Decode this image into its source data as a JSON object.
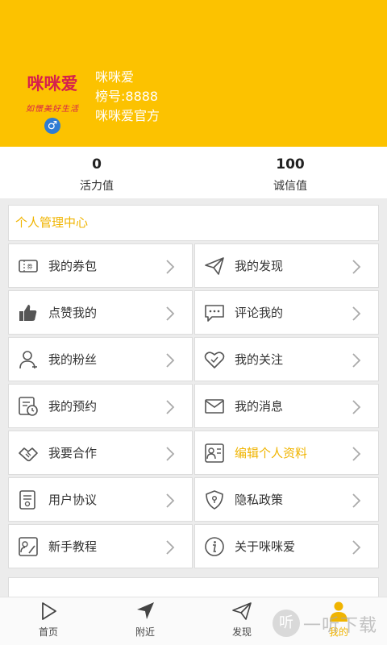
{
  "header": {
    "logo_text": "咪咪爱",
    "logo_sub": "如憬美好生活",
    "gender_symbol": "♂",
    "username": "咪咪爱",
    "rank": "榜号:8888",
    "official": "咪咪爱官方",
    "bg_color": "#fcc200"
  },
  "stats": [
    {
      "value": "0",
      "label": "活力值"
    },
    {
      "value": "100",
      "label": "诚信值"
    }
  ],
  "panel": {
    "title": "个人管理中心",
    "items": [
      {
        "label": "我的券包",
        "icon": "coupon-icon"
      },
      {
        "label": "我的发现",
        "icon": "paper-plane-icon"
      },
      {
        "label": "点赞我的",
        "icon": "thumbs-up-icon"
      },
      {
        "label": "评论我的",
        "icon": "comment-icon"
      },
      {
        "label": "我的粉丝",
        "icon": "user-icon"
      },
      {
        "label": "我的关注",
        "icon": "heart-icon"
      },
      {
        "label": "我的预约",
        "icon": "schedule-icon"
      },
      {
        "label": "我的消息",
        "icon": "envelope-icon"
      },
      {
        "label": "我要合作",
        "icon": "handshake-icon"
      },
      {
        "label": "编辑个人资料",
        "icon": "profile-card-icon",
        "highlight": true
      },
      {
        "label": "用户协议",
        "icon": "agreement-icon"
      },
      {
        "label": "隐私政策",
        "icon": "shield-icon"
      },
      {
        "label": "新手教程",
        "icon": "tutorial-icon"
      },
      {
        "label": "关于咪咪爱",
        "icon": "info-icon"
      }
    ]
  },
  "tabbar": [
    {
      "label": "首页",
      "icon": "play-icon"
    },
    {
      "label": "附近",
      "icon": "location-arrow-icon"
    },
    {
      "label": "发现",
      "icon": "paper-plane-icon"
    },
    {
      "label": "我的",
      "icon": "person-icon",
      "active": true
    }
  ],
  "watermark": {
    "circle": "听",
    "text": "一听下载"
  },
  "colors": {
    "accent": "#f0b400",
    "header": "#fcc200",
    "gender": "#2f7cd3",
    "logo": "#d6204d"
  }
}
